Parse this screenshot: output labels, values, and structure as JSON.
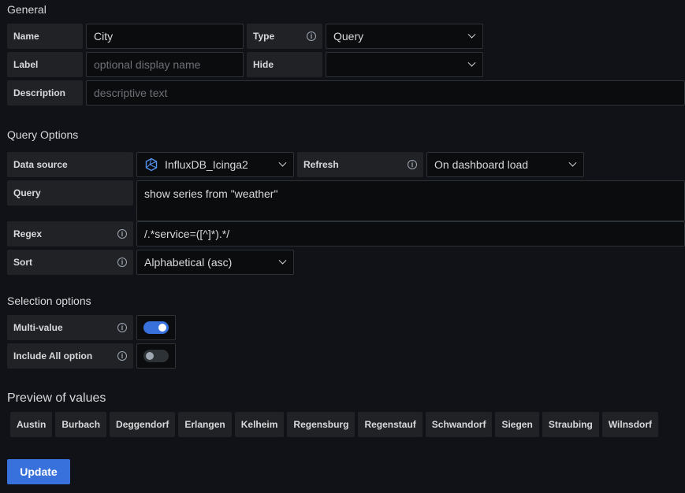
{
  "general": {
    "title": "General",
    "name_label": "Name",
    "name_value": "City",
    "type_label": "Type",
    "type_value": "Query",
    "label_label": "Label",
    "label_placeholder": "optional display name",
    "hide_label": "Hide",
    "hide_value": "",
    "description_label": "Description",
    "description_placeholder": "descriptive text"
  },
  "query_options": {
    "title": "Query Options",
    "datasource_label": "Data source",
    "datasource_value": "InfluxDB_Icinga2",
    "refresh_label": "Refresh",
    "refresh_value": "On dashboard load",
    "query_label": "Query",
    "query_value": "show series from \"weather\"",
    "regex_label": "Regex",
    "regex_value": "/.*service=([^]*).*/",
    "sort_label": "Sort",
    "sort_value": "Alphabetical (asc)"
  },
  "selection_options": {
    "title": "Selection options",
    "multi_value_label": "Multi-value",
    "multi_value_enabled": true,
    "include_all_label": "Include All option",
    "include_all_enabled": false
  },
  "preview": {
    "title": "Preview of values",
    "values": [
      "Austin",
      "Burbach",
      "Deggendorf",
      "Erlangen",
      "Kelheim",
      "Regensburg",
      "Regenstauf",
      "Schwandorf",
      "Siegen",
      "Straubing",
      "Wilnsdorf"
    ]
  },
  "actions": {
    "update_label": "Update"
  },
  "icons": {
    "info": "info-circle-icon",
    "chevron": "chevron-down-icon",
    "datasource": "influxdb-icon"
  },
  "colors": {
    "background": "#111217",
    "label_bg": "#202226",
    "input_bg": "#0b0c0e",
    "primary": "#3871dc"
  }
}
